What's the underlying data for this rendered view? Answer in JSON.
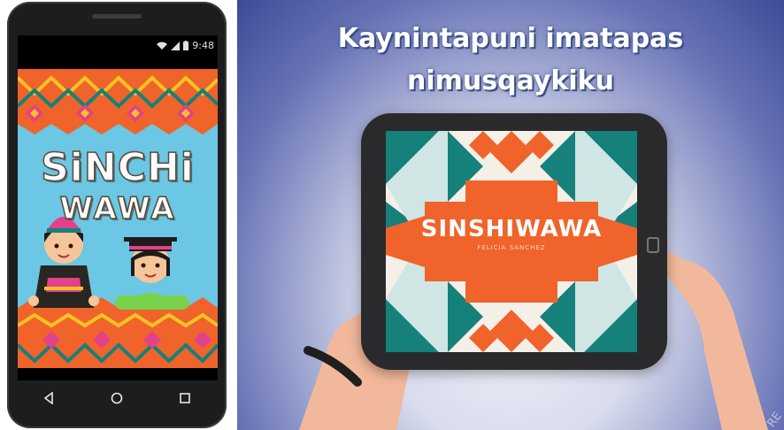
{
  "phone": {
    "status_time": "9:48",
    "icons": [
      "wifi-icon",
      "signal-icon",
      "battery-icon"
    ],
    "app_title_line1": "SiNCHi",
    "app_title_line2": "WAWA",
    "nav_icons": [
      "back-icon",
      "home-icon",
      "recents-icon"
    ]
  },
  "video": {
    "headline_line1": "Kaynintapuni imatapas",
    "headline_line2": "nimusqaykiku",
    "book_title": "SINSHIWAWA",
    "book_author": "FELICIA SANCHEZ",
    "watermark": "RE"
  },
  "colors": {
    "pattern_orange": "#f0632a",
    "pattern_teal": "#16807b",
    "pattern_yellow": "#f6c324",
    "pattern_pink": "#e2418c",
    "sky_blue": "#6bc7e3",
    "headline_outline": "#3b4f86"
  }
}
